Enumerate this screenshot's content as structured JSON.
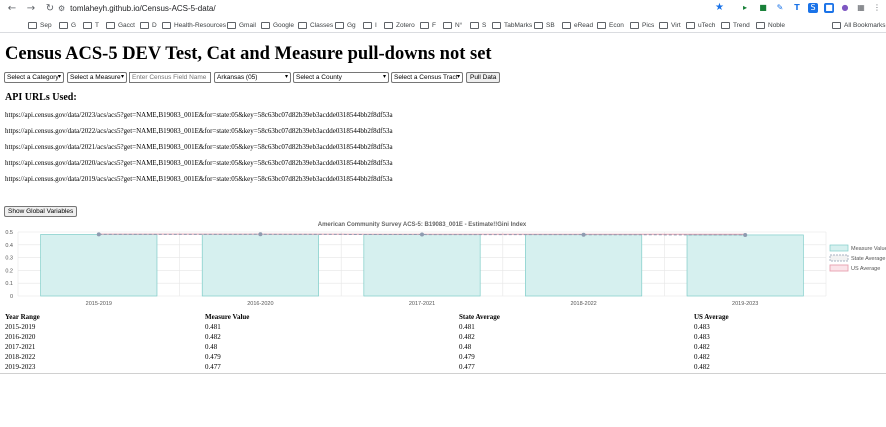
{
  "browser": {
    "url": "tomlaheyh.github.io/Census-ACS-5-data/",
    "all_bookmarks_label": "All Bookmarks",
    "bookmarks": [
      "Sep",
      "G",
      "T",
      "Gacct",
      "D",
      "Health-Resources",
      "Gmail",
      "Google",
      "Classes",
      "Gg",
      "I",
      "Zotero",
      "F",
      "N°",
      "S",
      "TabMarks",
      "SB",
      "eRead",
      "Econ",
      "Pics",
      "Virt",
      "uTech",
      "Trend",
      "Noble"
    ]
  },
  "page": {
    "title": "Census ACS-5 DEV Test, Cat and Measure pull-downs not set",
    "controls": {
      "category": "Select a Category",
      "measure": "Select a Measure",
      "field_placeholder": "Enter Census Field Name",
      "state": "Arkansas (05)",
      "county": "Select a County",
      "tract": "Select a Census Tract",
      "pull_button": "Pull Data"
    },
    "api_heading": "API URLs Used:",
    "api_urls": [
      "https://api.census.gov/data/2023/acs/acs5?get=NAME,B19083_001E&for=state:05&key=58c63bc07d82b39eb3acdde0318544bb2f8df53a",
      "https://api.census.gov/data/2022/acs/acs5?get=NAME,B19083_001E&for=state:05&key=58c63bc07d82b39eb3acdde0318544bb2f8df53a",
      "https://api.census.gov/data/2021/acs/acs5?get=NAME,B19083_001E&for=state:05&key=58c63bc07d82b39eb3acdde0318544bb2f8df53a",
      "https://api.census.gov/data/2020/acs/acs5?get=NAME,B19083_001E&for=state:05&key=58c63bc07d82b39eb3acdde0318544bb2f8df53a",
      "https://api.census.gov/data/2019/acs/acs5?get=NAME,B19083_001E&for=state:05&key=58c63bc07d82b39eb3acdde0318544bb2f8df53a"
    ],
    "show_globals_button": "Show Global Variables"
  },
  "chart_data": {
    "type": "bar",
    "title": "American Community Survey ACS-5: B19083_001E - Estimate!!Gini Index",
    "categories": [
      "2015-2019",
      "2016-2020",
      "2017-2021",
      "2018-2022",
      "2019-2023"
    ],
    "series": [
      {
        "name": "Measure Value",
        "type": "bar",
        "values": [
          0.481,
          0.482,
          0.48,
          0.479,
          0.477
        ],
        "color": "#d6f0ef",
        "border": "#7fcdc9"
      },
      {
        "name": "State Average",
        "type": "line",
        "values": [
          0.481,
          0.482,
          0.48,
          0.479,
          0.477
        ],
        "color": "#8e9bb0"
      },
      {
        "name": "US Average",
        "type": "line",
        "values": [
          0.483,
          0.483,
          0.482,
          0.482,
          0.482
        ],
        "color": "#e8a0b0"
      }
    ],
    "ylim": [
      0,
      0.5
    ],
    "yticks": [
      "0",
      "0.1",
      "0.2",
      "0.3",
      "0.4",
      "0.5"
    ],
    "legend_position": "right",
    "grid": true
  },
  "table": {
    "headers": [
      "Year Range",
      "Measure Value",
      "State Average",
      "US Average"
    ],
    "rows": [
      [
        "2015-2019",
        "0.481",
        "0.481",
        "0.483"
      ],
      [
        "2016-2020",
        "0.482",
        "0.482",
        "0.483"
      ],
      [
        "2017-2021",
        "0.48",
        "0.48",
        "0.482"
      ],
      [
        "2018-2022",
        "0.479",
        "0.479",
        "0.482"
      ],
      [
        "2019-2023",
        "0.477",
        "0.477",
        "0.482"
      ]
    ]
  }
}
